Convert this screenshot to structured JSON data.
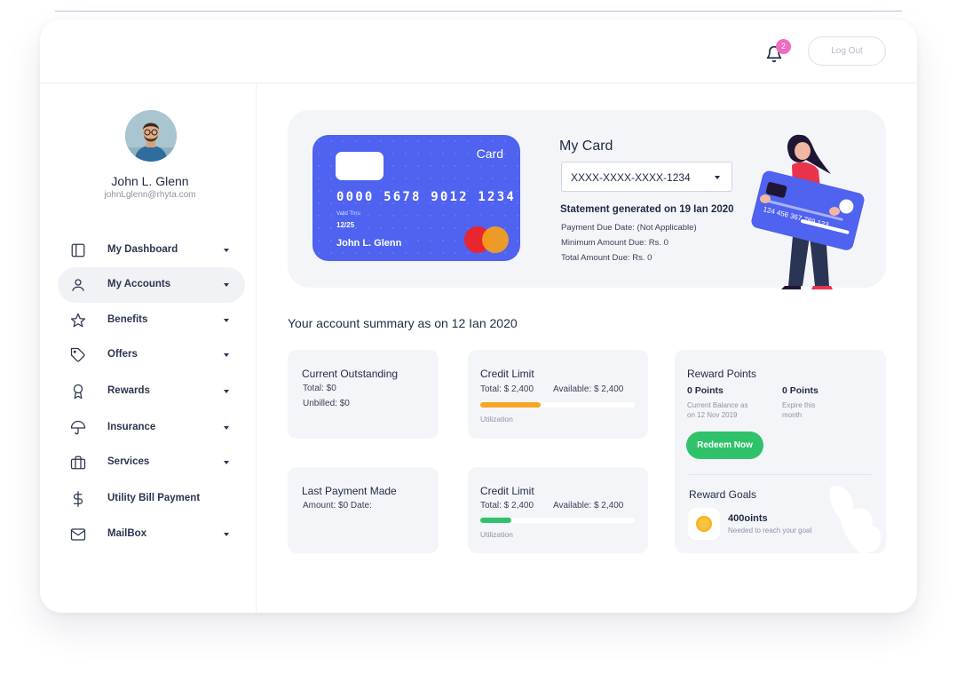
{
  "header": {
    "notification_count": "2",
    "logout_label": "Log Out"
  },
  "user": {
    "name": "John  L. Glenn",
    "email": "johnLglenn@rhyta.com"
  },
  "sidebar": {
    "items": [
      {
        "label": "My Dashboard",
        "icon": "dashboard-icon",
        "has_caret": true,
        "active": false
      },
      {
        "label": "My Accounts",
        "icon": "user-icon",
        "has_caret": true,
        "active": true
      },
      {
        "label": "Benefits",
        "icon": "star-icon",
        "has_caret": true,
        "active": false
      },
      {
        "label": "Offers",
        "icon": "tag-icon",
        "has_caret": true,
        "active": false
      },
      {
        "label": "Rewards",
        "icon": "award-icon",
        "has_caret": true,
        "active": false
      },
      {
        "label": "Insurance",
        "icon": "umbrella-icon",
        "has_caret": true,
        "active": false
      },
      {
        "label": "Services",
        "icon": "briefcase-icon",
        "has_caret": true,
        "active": false
      },
      {
        "label": "Utility Bill Payment",
        "icon": "dollar-icon",
        "has_caret": false,
        "active": false
      },
      {
        "label": "MailBox",
        "icon": "mail-icon",
        "has_caret": true,
        "active": false
      }
    ]
  },
  "card": {
    "type_label": "Card",
    "number": "0000 5678 9012 1234",
    "valid_label": "Valid Thru",
    "valid_value": "12/25",
    "holder": "John L. Glenn",
    "illustration_number": "124 456 367 789 123"
  },
  "my_card": {
    "title": "My Card",
    "selected_card": "XXXX-XXXX-XXXX-1234",
    "statement": "Statement generated on 19  Ian 2020",
    "payment_due": "Payment Due Date: (Not Applicable)",
    "min_due": "Minimum Amount Due: Rs. 0",
    "total_due": "Total Amount Due: Rs. 0"
  },
  "summary": {
    "title": "Your account summary as on 12  Ian 2020",
    "current_outstanding": {
      "title": "Current  Outstanding",
      "total": "Total: $0",
      "unbilled": "Unbilled: $0"
    },
    "credit_limit_1": {
      "title": "Credit  Limit",
      "total": "Total: $ 2,400",
      "available": "Available: $ 2,400",
      "utilization_label": "Utilization",
      "utilization": 0.39
    },
    "last_payment": {
      "title": "Last  Payment  Made",
      "amount": "Amount: $0 Date:"
    },
    "credit_limit_2": {
      "title": "Credit  Limit",
      "total": "Total: $ 2,400",
      "available": "Available: $ 2,400",
      "utilization_label": "Utilization",
      "utilization": 0.2
    }
  },
  "rewards": {
    "title": "Reward  Points",
    "balance_points": "0 Points",
    "balance_label_1": "Current Balance as",
    "balance_label_2": "on 12 Nov 2019",
    "expire_points": "0 Points",
    "expire_label_1": "Expire this",
    "expire_label_2": "month",
    "redeem_label": "Redeem Now",
    "goals_title": "Reward Goals",
    "goal_value": "400oints",
    "goal_sub": "Needed to reach your goal"
  },
  "colors": {
    "primary": "#4f62f0",
    "orange_bar": "#f5a623",
    "green_bar": "#2fc26a",
    "badge": "#f06cc1",
    "redeem": "#2fc26a"
  }
}
